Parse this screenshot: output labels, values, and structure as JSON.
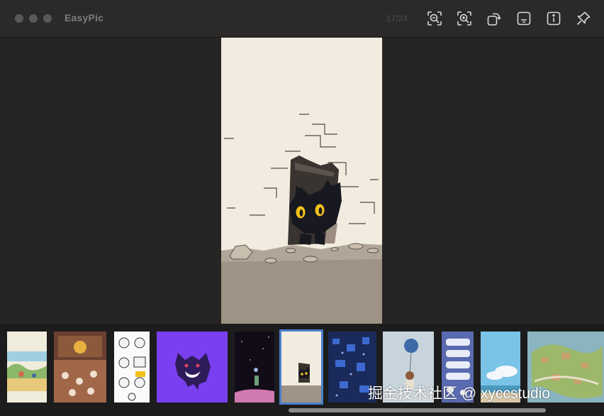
{
  "window": {
    "title": "EasyPic",
    "counter": "17/24"
  },
  "toolbar": {
    "buttons": [
      {
        "icon": "zoom-out-icon"
      },
      {
        "icon": "zoom-in-icon"
      },
      {
        "icon": "rotate-icon"
      },
      {
        "icon": "caption-icon"
      },
      {
        "icon": "info-icon"
      },
      {
        "icon": "pin-icon"
      }
    ]
  },
  "filmstrip": {
    "count": 12,
    "selected_index": 6
  },
  "watermark": "掘金技术社区 @ xyccstudio",
  "colors": {
    "selection": "#4a7fcc",
    "background": "#262524",
    "titlebar": "#2b2a29"
  }
}
